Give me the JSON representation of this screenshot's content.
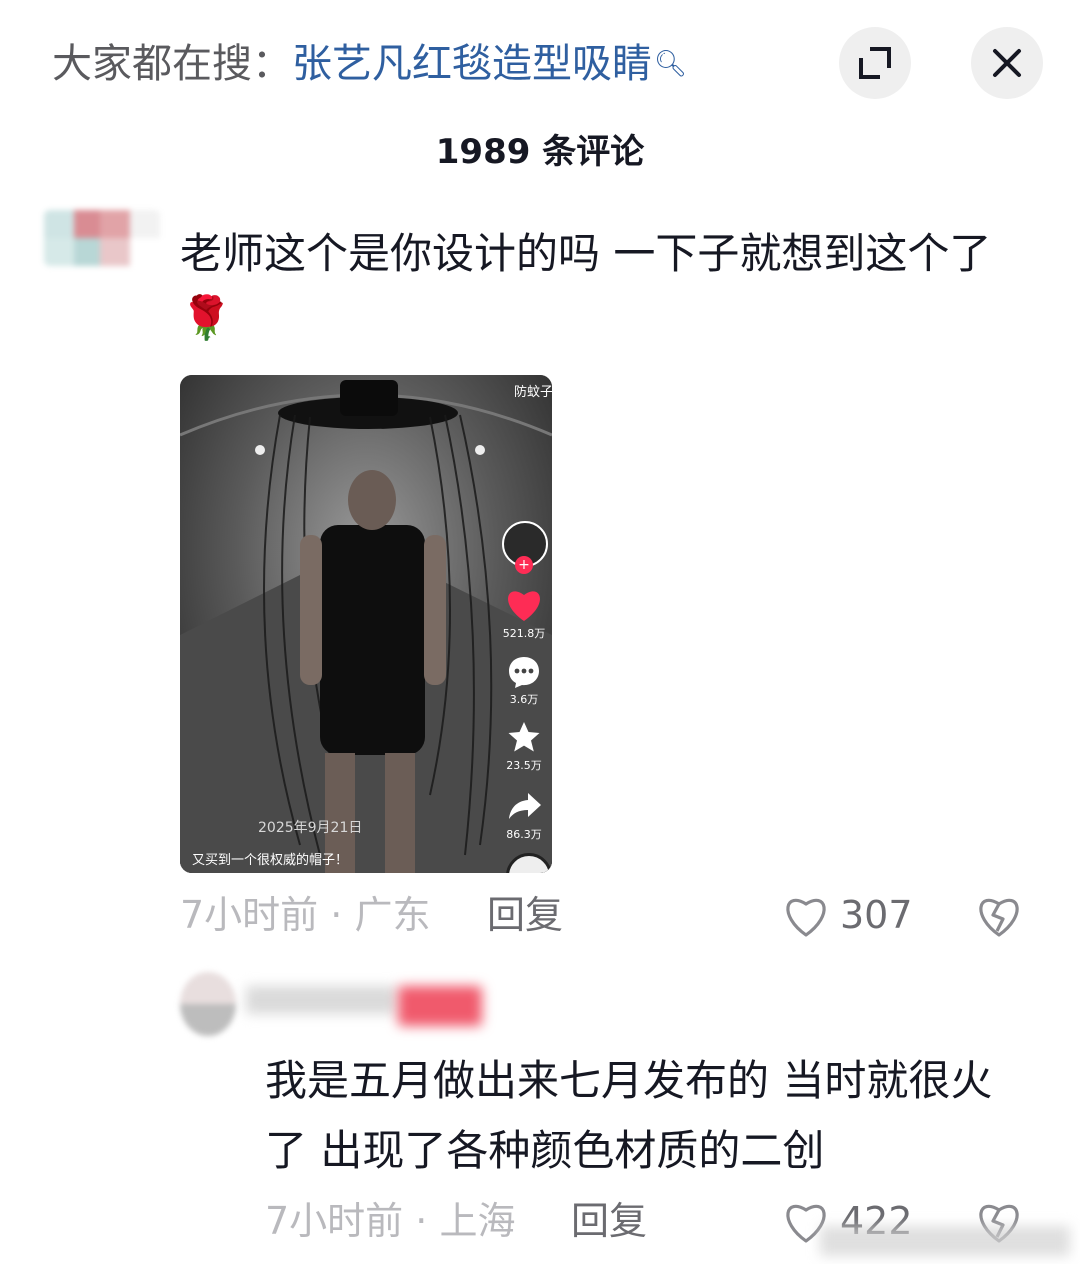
{
  "header": {
    "search_label": "大家都在搜：",
    "search_keyword": "张艺凡红毯造型吸睛",
    "comment_count": "1989 条评论"
  },
  "comment": {
    "text": "老师这个是你设计的吗 一下子就想到这个了🌹",
    "time": "7小时前",
    "location": "广东",
    "reply_label": "回复",
    "likes": "307",
    "video": {
      "top_tag": "防蚊子",
      "date": "2025年9月21日",
      "caption": "又买到一个很权威的帽子！",
      "likes": "521.8万",
      "comments": "3.6万",
      "favorites": "23.5万",
      "shares": "86.3万"
    }
  },
  "reply": {
    "text": "我是五月做出来七月发布的 当时就很火了 出现了各种颜色材质的二创",
    "time": "7小时前",
    "location": "上海",
    "reply_label": "回复",
    "likes": "422"
  },
  "colors": {
    "keyword": "#2f5fa0",
    "like_red": "#fe2c55",
    "meta_gray": "#b9b9bd"
  }
}
